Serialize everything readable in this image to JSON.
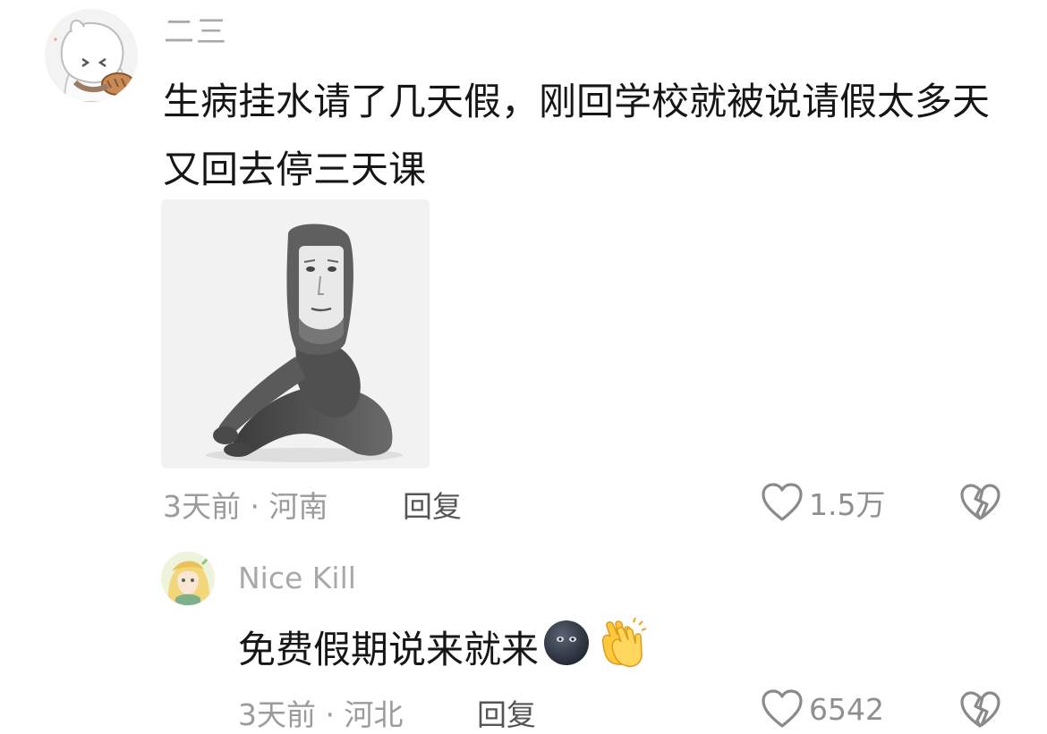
{
  "comment": {
    "author": "二三",
    "text": "生病挂水请了几天假，刚回学校就被说请假太多天又回去停三天课",
    "time_location": "3天前 · 河南",
    "reply_label": "回复",
    "like_count": "1.5万"
  },
  "reply": {
    "author": "Nice Kill",
    "text": "免费假期说来就来",
    "emojis": [
      "new-moon-face-emoji",
      "clapping-hands-emoji"
    ],
    "time_location": "3天前 · 河北",
    "reply_label": "回复",
    "like_count": "6542"
  },
  "icons": {
    "like": "heart-outline-icon",
    "dislike": "broken-heart-icon"
  },
  "colors": {
    "text": "#161616",
    "muted": "#9b9b9b",
    "author": "#a9a9a9",
    "reply_btn": "#555555"
  }
}
